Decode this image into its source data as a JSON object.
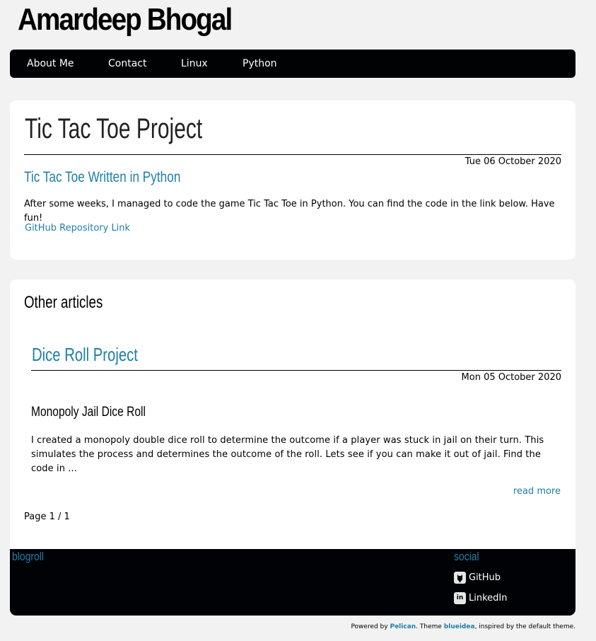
{
  "site": {
    "title": "Amardeep Bhogal"
  },
  "nav": {
    "items": [
      {
        "label": "About Me"
      },
      {
        "label": "Contact"
      },
      {
        "label": "Linux"
      },
      {
        "label": "Python"
      }
    ]
  },
  "article": {
    "title": "Tic Tac Toe Project",
    "date": "Tue 06 October 2020",
    "subtitle": "Tic Tac Toe Written in Python",
    "body": "After some weeks, I managed to code the game Tic Tac Toe in Python. You can find the code in the link below. Have fun!",
    "link_label": "GitHub Repository Link"
  },
  "other_articles": {
    "heading": "Other articles",
    "entries": [
      {
        "title": "Dice Roll Project",
        "date": "Mon 05 October 2020",
        "heading": "Monopoly Jail Dice Roll",
        "summary": "I created a monopoly double dice roll to determine the outcome if a player was stuck in jail on their turn. This simulates the process and determines the outcome of the roll. Lets see if you can make it out of jail. Find the code in ...",
        "read_more": "read more"
      }
    ],
    "paging": "Page 1 / 1"
  },
  "footer": {
    "blogroll_heading": "blogroll",
    "social_heading": "social",
    "social_links": [
      {
        "label": "GitHub",
        "icon": "github-icon"
      },
      {
        "label": "LinkedIn",
        "icon": "linkedin-icon",
        "glyph": "in"
      }
    ]
  },
  "powered": {
    "prefix": "Powered by",
    "pelican": "Pelican",
    "middle": ". Theme",
    "theme": "blueidea",
    "suffix": ", inspired by the default theme."
  },
  "colors": {
    "accent": "#1e7fa8",
    "navbar": "#000205",
    "page_background": "#f1f2f1"
  }
}
